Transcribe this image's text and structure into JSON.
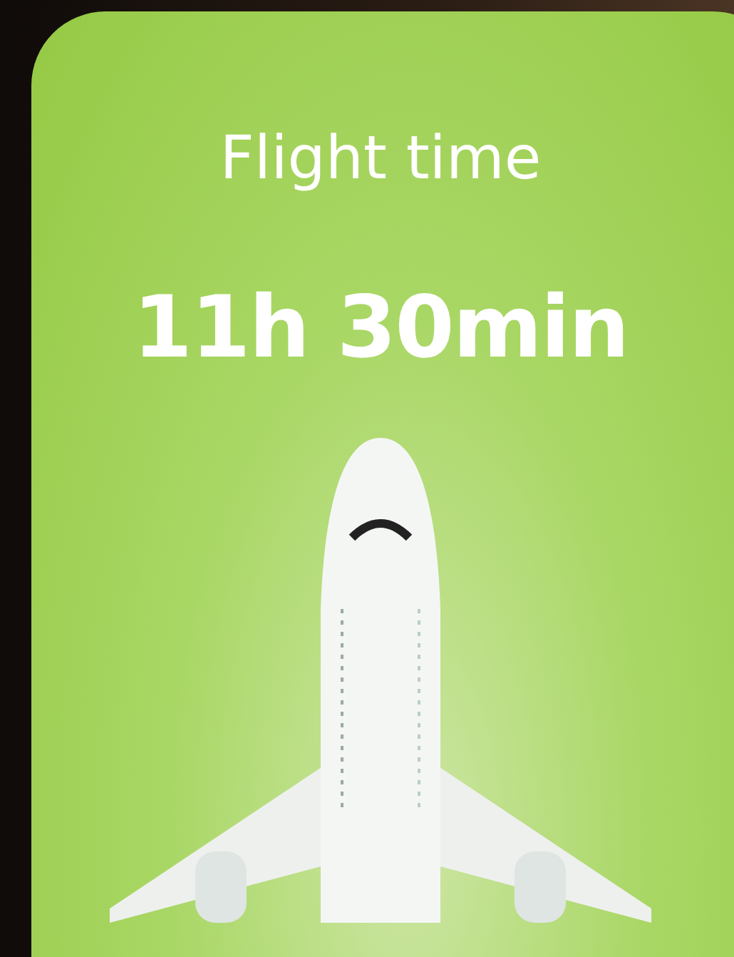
{
  "card": {
    "title": "Flight time",
    "duration": "11h 30min"
  }
}
